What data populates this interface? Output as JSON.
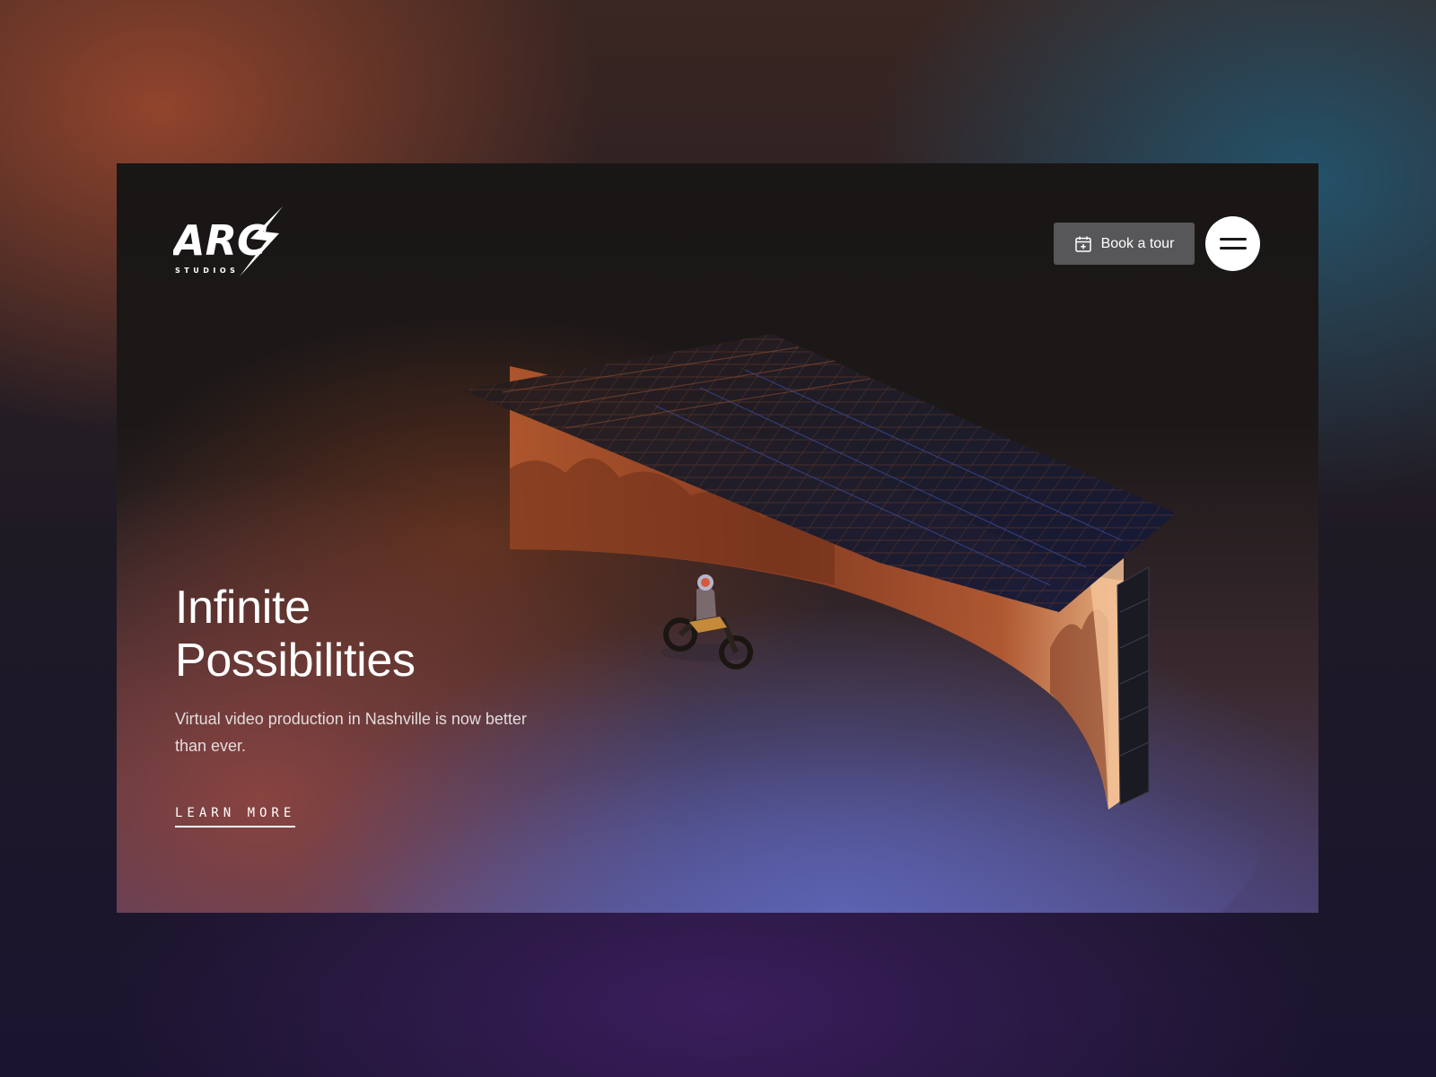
{
  "brand": {
    "logo_mark": "ARC",
    "logo_sub": "STUDIOS"
  },
  "header": {
    "book_tour_label": "Book a tour",
    "menu_icon": "hamburger-menu-icon",
    "book_icon": "calendar-plus-icon"
  },
  "hero": {
    "headline_line1": "Infinite",
    "headline_line2": "Possibilities",
    "subtext": "Virtual video production in Nashville is now better than ever.",
    "cta_label": "LEARN MORE",
    "image_alt_subject": "LED volume stage with motorcycle rider"
  },
  "colors": {
    "button_bg": "#57575a",
    "menu_bg": "#ffffff",
    "text_primary": "#ffffff",
    "accent_warm": "#c0653a",
    "accent_cool": "#4a52a0"
  }
}
